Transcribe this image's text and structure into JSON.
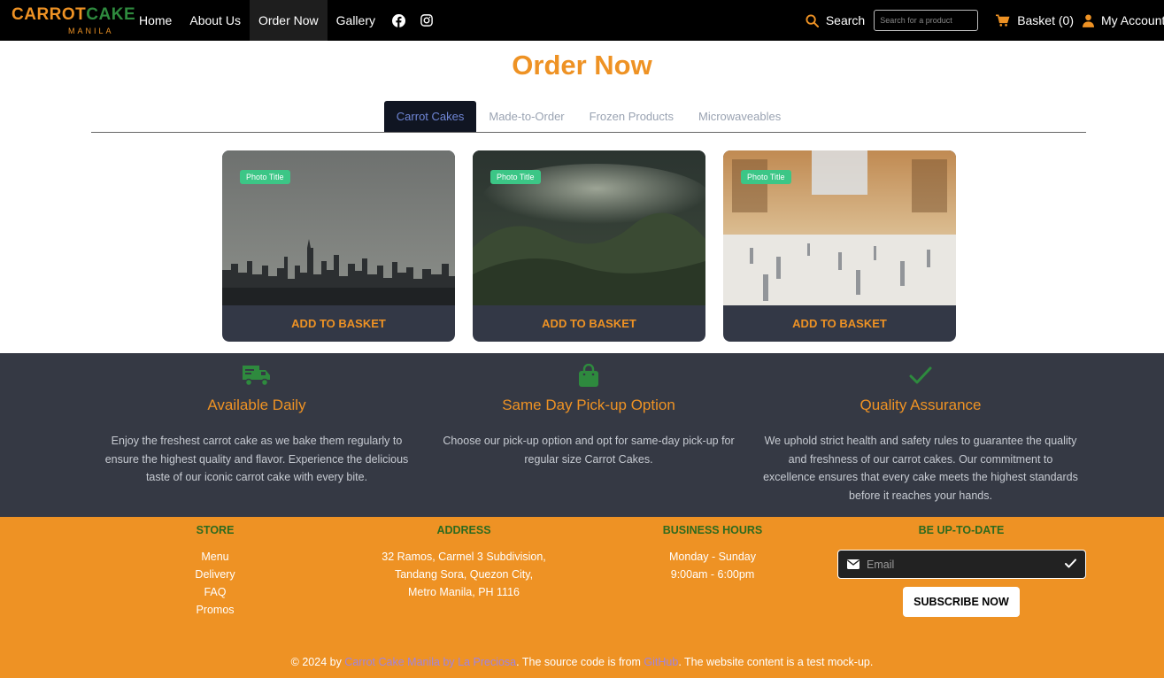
{
  "brand": {
    "name_part1": "CARROT",
    "name_part2": "CAKE",
    "subtitle": "MANILA"
  },
  "nav": {
    "links": [
      "Home",
      "About Us",
      "Order Now",
      "Gallery"
    ],
    "active_index": 2,
    "icons": [
      "facebook-icon",
      "instagram-icon"
    ],
    "search_label": "Search",
    "search_placeholder": "Search for a product",
    "basket_label": "Basket (0)",
    "account_label": "My Account"
  },
  "page": {
    "title": "Order Now"
  },
  "tabs": {
    "items": [
      "Carrot Cakes",
      "Made-to-Order",
      "Frozen Products",
      "Microwaveables"
    ],
    "active_index": 0
  },
  "products": [
    {
      "badge": "Photo Title",
      "button": "ADD TO BASKET"
    },
    {
      "badge": "Photo Title",
      "button": "ADD TO BASKET"
    },
    {
      "badge": "Photo Title",
      "button": "ADD TO BASKET"
    }
  ],
  "features": [
    {
      "icon": "truck-icon",
      "title": "Available Daily",
      "text": "Enjoy the freshest carrot cake as we bake them regularly to ensure the highest quality and flavor. Experience the delicious taste of our iconic carrot cake with every bite."
    },
    {
      "icon": "shopping-bag-icon",
      "title": "Same Day Pick-up Option",
      "text": "Choose our pick-up option and opt for same-day pick-up for regular size Carrot Cakes."
    },
    {
      "icon": "check-icon",
      "title": "Quality Assurance",
      "text": "We uphold strict health and safety rules to guarantee the quality and freshness of our carrot cakes. Our commitment to excellence ensures that every cake meets the highest standards before it reaches your hands."
    }
  ],
  "footer": {
    "store": {
      "heading": "STORE",
      "items": [
        "Menu",
        "Delivery",
        "FAQ",
        "Promos"
      ]
    },
    "address": {
      "heading": "ADDRESS",
      "lines": [
        "32 Ramos, Carmel 3 Subdivision,",
        "Tandang Sora, Quezon City,",
        "Metro Manila, PH 1116"
      ]
    },
    "hours": {
      "heading": "BUSINESS HOURS",
      "lines": [
        "Monday - Sunday",
        "9:00am - 6:00pm"
      ]
    },
    "newsletter": {
      "heading": "BE UP-TO-DATE",
      "email_placeholder": "Email",
      "button": "SUBSCRIBE NOW"
    },
    "copyright": {
      "prefix": "© 2024 by ",
      "brand_link": "Carrot Cake Manila by La Preciosa",
      "middle": ". The source code is from ",
      "source_link": "GitHub",
      "suffix": ". The website content is a test mock-up."
    }
  },
  "colors": {
    "accent": "#ee9224",
    "green": "#2e8a3e",
    "dark_panel": "#353944",
    "badge": "#3cc686",
    "link": "#a084e0"
  }
}
